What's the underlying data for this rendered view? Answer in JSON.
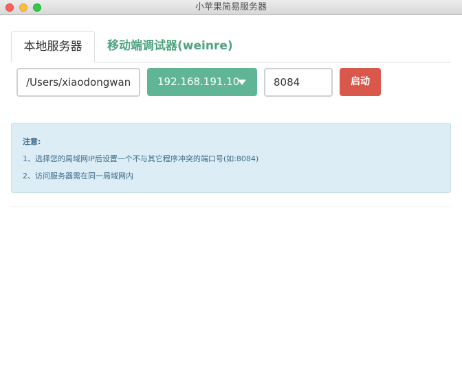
{
  "window": {
    "title": "小苹果简易服务器"
  },
  "tabs": [
    {
      "label": "本地服务器",
      "active": true
    },
    {
      "label": "移动端调试器(weinre)",
      "active": false
    }
  ],
  "controls": {
    "path_value": "/Users/xiaodongwang/",
    "ip_selected": "192.168.191.10",
    "port_value": "8084",
    "start_label": "启动"
  },
  "notice": {
    "heading": "注意:",
    "lines": [
      "1、选择您的局域网IP后设置一个不与其它程序冲突的端口号(如:8084)",
      "2、访问服务器需在同一局域网内"
    ]
  },
  "colors": {
    "accent_green": "#5fb595",
    "tab_green": "#4fa37f",
    "danger_red": "#d9574b",
    "notice_bg": "#dcedf5",
    "notice_text": "#3e6b8a"
  },
  "icons": {
    "dropdown": "caret-down-icon"
  }
}
